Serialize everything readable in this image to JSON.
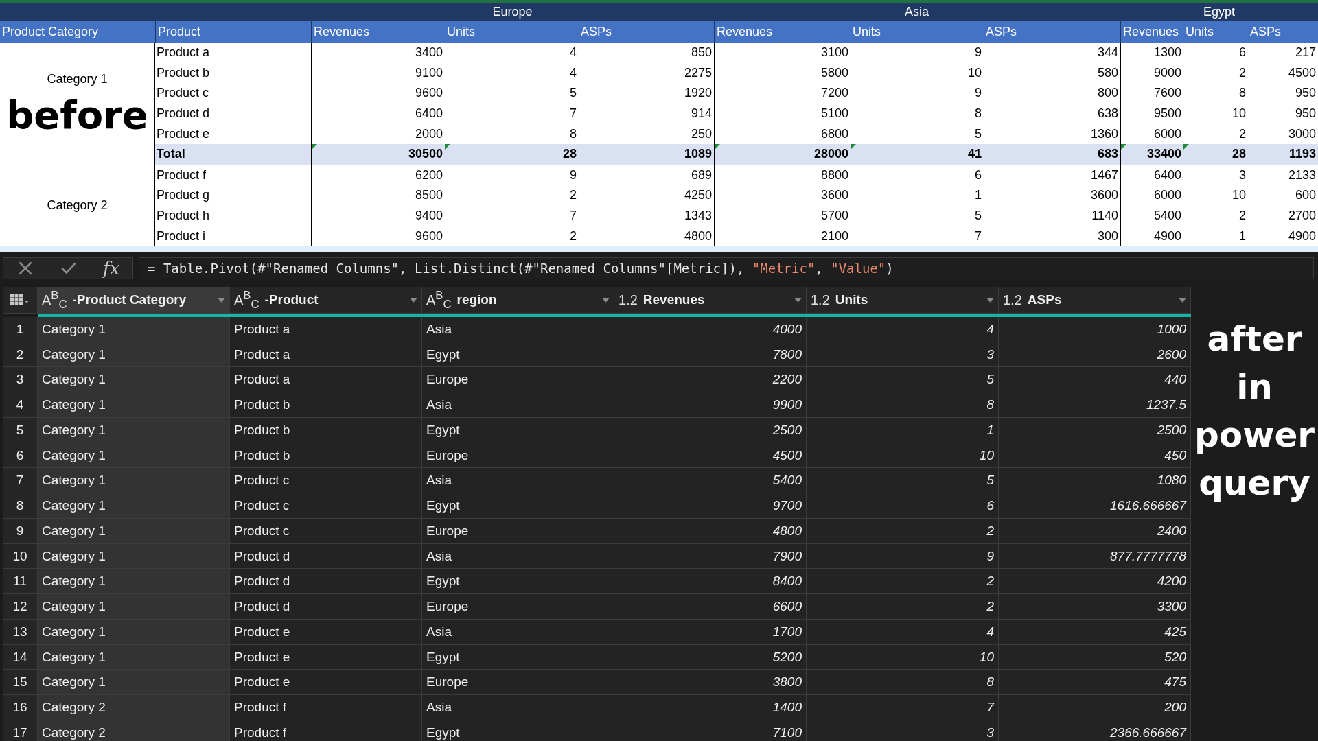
{
  "excel": {
    "regions": [
      {
        "name": "Europe"
      },
      {
        "name": "Asia"
      },
      {
        "name": "Egypt"
      }
    ],
    "columns": [
      "Product Category",
      "Product",
      "Revenues",
      "Units",
      "ASPs",
      "Revenues",
      "Units",
      "ASPs",
      "Revenues",
      "Units",
      "ASPs"
    ],
    "groups": [
      {
        "category": "Category 1",
        "note": "before",
        "rows": [
          {
            "kind": "item",
            "product": "Product a",
            "values": [
              "3400",
              "4",
              "850",
              "3100",
              "9",
              "344",
              "1300",
              "6",
              "217"
            ]
          },
          {
            "kind": "item",
            "product": "Product b",
            "values": [
              "9100",
              "4",
              "2275",
              "5800",
              "10",
              "580",
              "9000",
              "2",
              "4500"
            ]
          },
          {
            "kind": "item",
            "product": "Product c",
            "values": [
              "9600",
              "5",
              "1920",
              "7200",
              "9",
              "800",
              "7600",
              "8",
              "950"
            ]
          },
          {
            "kind": "item",
            "product": "Product d",
            "values": [
              "6400",
              "7",
              "914",
              "5100",
              "8",
              "638",
              "9500",
              "10",
              "950"
            ]
          },
          {
            "kind": "item",
            "product": "Product e",
            "values": [
              "2000",
              "8",
              "250",
              "6800",
              "5",
              "1360",
              "6000",
              "2",
              "3000"
            ]
          },
          {
            "kind": "total",
            "product": "Total",
            "values": [
              "30500",
              "28",
              "1089",
              "28000",
              "41",
              "683",
              "33400",
              "28",
              "1193"
            ],
            "warnings": [
              true,
              true,
              false,
              true,
              true,
              false,
              true,
              true,
              false
            ]
          }
        ]
      },
      {
        "category": "Category 2",
        "rows": [
          {
            "kind": "item",
            "product": "Product f",
            "values": [
              "6200",
              "9",
              "689",
              "8800",
              "6",
              "1467",
              "6400",
              "3",
              "2133"
            ]
          },
          {
            "kind": "item",
            "product": "Product g",
            "values": [
              "8500",
              "2",
              "4250",
              "3600",
              "1",
              "3600",
              "6000",
              "10",
              "600"
            ]
          },
          {
            "kind": "item",
            "product": "Product h",
            "values": [
              "9400",
              "7",
              "1343",
              "5700",
              "5",
              "1140",
              "5400",
              "2",
              "2700"
            ]
          },
          {
            "kind": "item",
            "product": "Product i",
            "values": [
              "9600",
              "2",
              "4800",
              "2100",
              "7",
              "300",
              "4900",
              "1",
              "4900"
            ]
          }
        ]
      }
    ]
  },
  "power_query": {
    "formula_bar": {
      "fx": "fx",
      "formula": [
        {
          "kind": "plain",
          "text": "= Table.Pivot(#\"Renamed Columns\", List.Distinct(#\"Renamed Columns\"[Metric]), "
        },
        {
          "kind": "string",
          "text": "\"Metric\""
        },
        {
          "kind": "plain",
          "text": ", "
        },
        {
          "kind": "string",
          "text": "\"Value\""
        },
        {
          "kind": "plain",
          "text": ")"
        }
      ]
    },
    "columns": [
      {
        "type": "A$^{B}$$_{C}$",
        "name": "-Product Category",
        "kind": "text",
        "selected": true
      },
      {
        "type": "A$^{B}$$_{C}$",
        "name": "-Product",
        "kind": "text",
        "selected": false
      },
      {
        "type": "A$^{B}$$_{C}$",
        "name": "region",
        "kind": "text",
        "selected": false
      },
      {
        "type": "1.2",
        "name": "Revenues",
        "kind": "number",
        "selected": false
      },
      {
        "type": "1.2",
        "name": "Units",
        "kind": "number",
        "selected": false
      },
      {
        "type": "1.2",
        "name": "ASPs",
        "kind": "number",
        "selected": false
      }
    ],
    "rows": [
      {
        "number": "1",
        "cells": [
          "Category 1",
          "Product a",
          "Asia",
          "4000",
          "4",
          "1000"
        ]
      },
      {
        "number": "2",
        "cells": [
          "Category 1",
          "Product a",
          "Egypt",
          "7800",
          "3",
          "2600"
        ]
      },
      {
        "number": "3",
        "cells": [
          "Category 1",
          "Product a",
          "Europe",
          "2200",
          "5",
          "440"
        ]
      },
      {
        "number": "4",
        "cells": [
          "Category 1",
          "Product b",
          "Asia",
          "9900",
          "8",
          "1237.5"
        ]
      },
      {
        "number": "5",
        "cells": [
          "Category 1",
          "Product b",
          "Egypt",
          "2500",
          "1",
          "2500"
        ]
      },
      {
        "number": "6",
        "cells": [
          "Category 1",
          "Product b",
          "Europe",
          "4500",
          "10",
          "450"
        ]
      },
      {
        "number": "7",
        "cells": [
          "Category 1",
          "Product c",
          "Asia",
          "5400",
          "5",
          "1080"
        ]
      },
      {
        "number": "8",
        "cells": [
          "Category 1",
          "Product c",
          "Egypt",
          "9700",
          "6",
          "1616.666667"
        ]
      },
      {
        "number": "9",
        "cells": [
          "Category 1",
          "Product c",
          "Europe",
          "4800",
          "2",
          "2400"
        ]
      },
      {
        "number": "10",
        "cells": [
          "Category 1",
          "Product d",
          "Asia",
          "7900",
          "9",
          "877.7777778"
        ]
      },
      {
        "number": "11",
        "cells": [
          "Category 1",
          "Product d",
          "Egypt",
          "8400",
          "2",
          "4200"
        ]
      },
      {
        "number": "12",
        "cells": [
          "Category 1",
          "Product d",
          "Europe",
          "6600",
          "2",
          "3300"
        ]
      },
      {
        "number": "13",
        "cells": [
          "Category 1",
          "Product e",
          "Asia",
          "1700",
          "4",
          "425"
        ]
      },
      {
        "number": "14",
        "cells": [
          "Category 1",
          "Product e",
          "Egypt",
          "5200",
          "10",
          "520"
        ]
      },
      {
        "number": "15",
        "cells": [
          "Category 1",
          "Product e",
          "Europe",
          "3800",
          "8",
          "475"
        ]
      },
      {
        "number": "16",
        "cells": [
          "Category 2",
          "Product f",
          "Asia",
          "1400",
          "7",
          "200"
        ]
      },
      {
        "number": "17",
        "cells": [
          "Category 2",
          "Product f",
          "Egypt",
          "7100",
          "3",
          "2366.666667"
        ]
      }
    ],
    "note": [
      "after",
      "in",
      "power",
      "query"
    ]
  }
}
